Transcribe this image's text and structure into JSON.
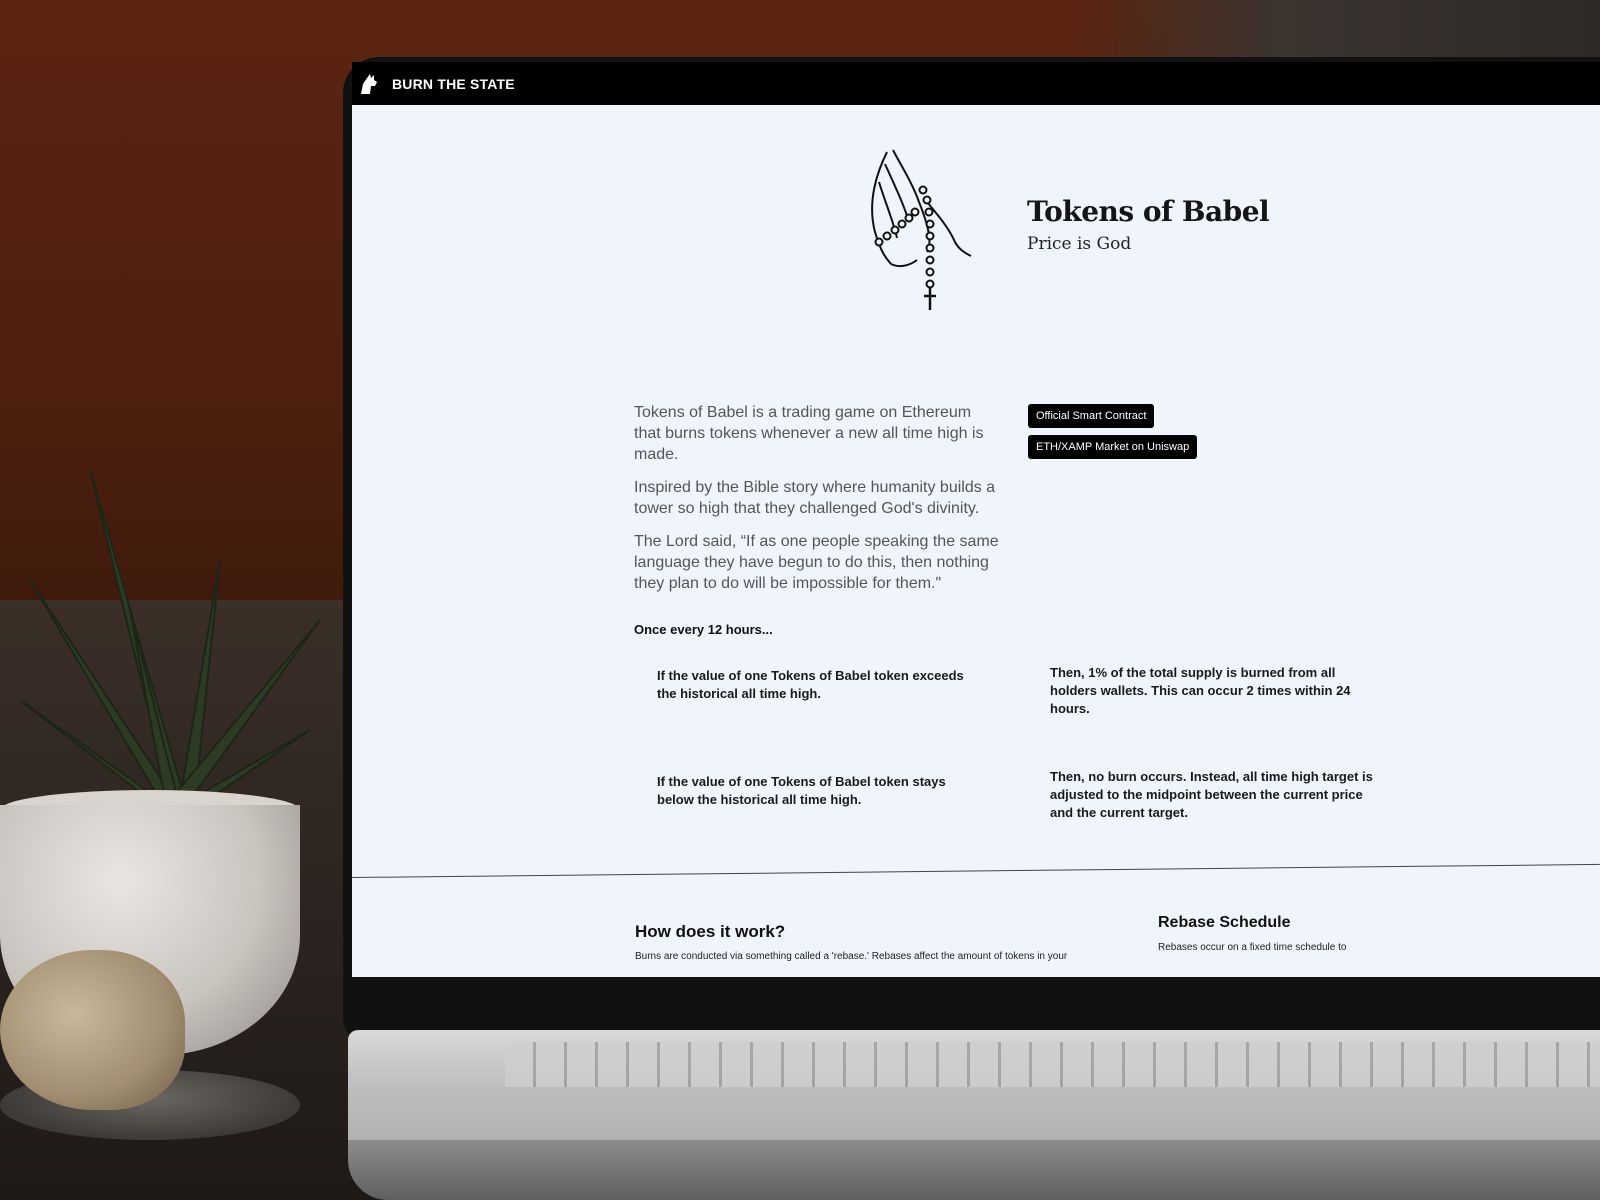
{
  "nav": {
    "brand": "BURN THE STATE"
  },
  "hero": {
    "title": "Tokens of Babel",
    "subtitle": "Price is God"
  },
  "intro": {
    "p1": "Tokens of Babel is a trading game on Ethereum that burns tokens whenever a new all time high is made.",
    "p2": "Inspired by the Bible story where humanity builds a tower so high that they challenged God's divinity.",
    "p3": "The Lord said, “If as one people speaking the same language they have begun to do this, then nothing they plan to do will be impossible for them.\""
  },
  "buttons": {
    "contract": "Official Smart Contract",
    "market": "ETH/XAMP Market on Uniswap"
  },
  "rules": {
    "heading": "Once every 12 hours...",
    "if_exceeds": "If the value of one Tokens of Babel token exceeds the historical all time high.",
    "then_burn": "Then, 1% of the total supply is burned from all holders wallets. This can occur 2 times within 24 hours.",
    "if_below": "If the value of one Tokens of Babel token stays below the historical all time high.",
    "then_no_burn": "Then, no burn occurs. Instead, all time high target is adjusted to the midpoint between the current price and the current target."
  },
  "how": {
    "title": "How does it work?",
    "text": "Burns are conducted via something called a 'rebase.' Rebases affect the amount of tokens in your"
  },
  "rebase": {
    "title": "Rebase Schedule",
    "text": "Rebases occur on a fixed time schedule to"
  }
}
